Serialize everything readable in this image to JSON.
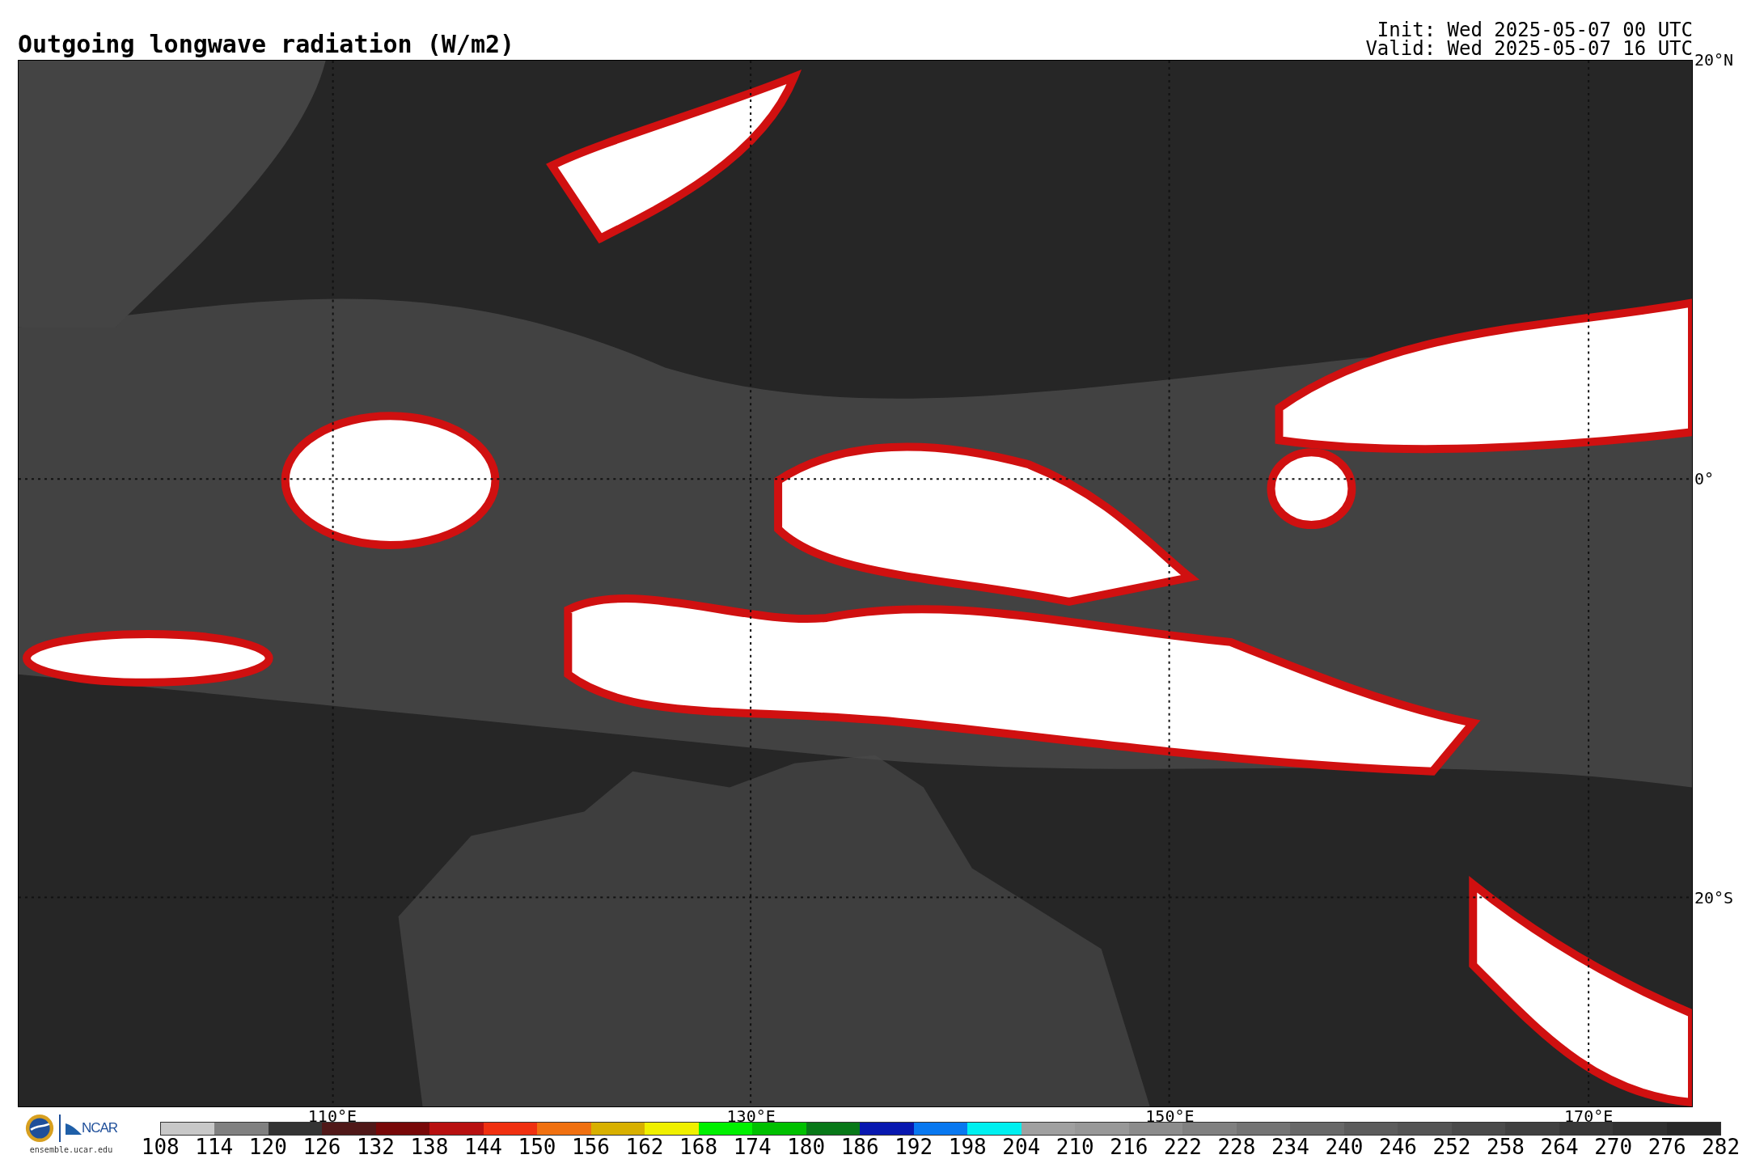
{
  "title": "Outgoing longwave radiation (W/m2)",
  "init": "Init: Wed 2025-05-07 00 UTC",
  "valid": "Valid: Wed 2025-05-07 16 UTC",
  "map": {
    "lat_labels": [
      "20°N",
      "0°",
      "20°S"
    ],
    "lon_labels": [
      "110°E",
      "130°E",
      "150°E",
      "170°E"
    ]
  },
  "logo": {
    "org": "NCAR",
    "url": "ensemble.ucar.edu"
  },
  "colorbar": {
    "segments": [
      {
        "color": "#c8c8c8"
      },
      {
        "color": "#808080"
      },
      {
        "color": "#343434"
      },
      {
        "color": "#501818"
      },
      {
        "color": "#780808"
      },
      {
        "color": "#b81010"
      },
      {
        "color": "#f03010"
      },
      {
        "color": "#f07010"
      },
      {
        "color": "#d8b000"
      },
      {
        "color": "#f0f000"
      },
      {
        "color": "#00f000"
      },
      {
        "color": "#00c000"
      },
      {
        "color": "#087818"
      },
      {
        "color": "#0818b0"
      },
      {
        "color": "#0878f0"
      },
      {
        "color": "#00f0f0"
      },
      {
        "color": "#a0a0a0"
      },
      {
        "color": "#989898"
      },
      {
        "color": "#8c8c8c"
      },
      {
        "color": "#808080"
      },
      {
        "color": "#747474"
      },
      {
        "color": "#686868"
      },
      {
        "color": "#5c5c5c"
      },
      {
        "color": "#545454"
      },
      {
        "color": "#4a4a4a"
      },
      {
        "color": "#404040"
      },
      {
        "color": "#383838"
      },
      {
        "color": "#303030"
      },
      {
        "color": "#282828"
      }
    ],
    "ticks": [
      "108",
      "114",
      "120",
      "126",
      "132",
      "138",
      "144",
      "150",
      "156",
      "162",
      "168",
      "174",
      "180",
      "186",
      "192",
      "198",
      "204",
      "210",
      "216",
      "222",
      "228",
      "234",
      "240",
      "246",
      "252",
      "258",
      "264",
      "270",
      "276",
      "282"
    ]
  }
}
